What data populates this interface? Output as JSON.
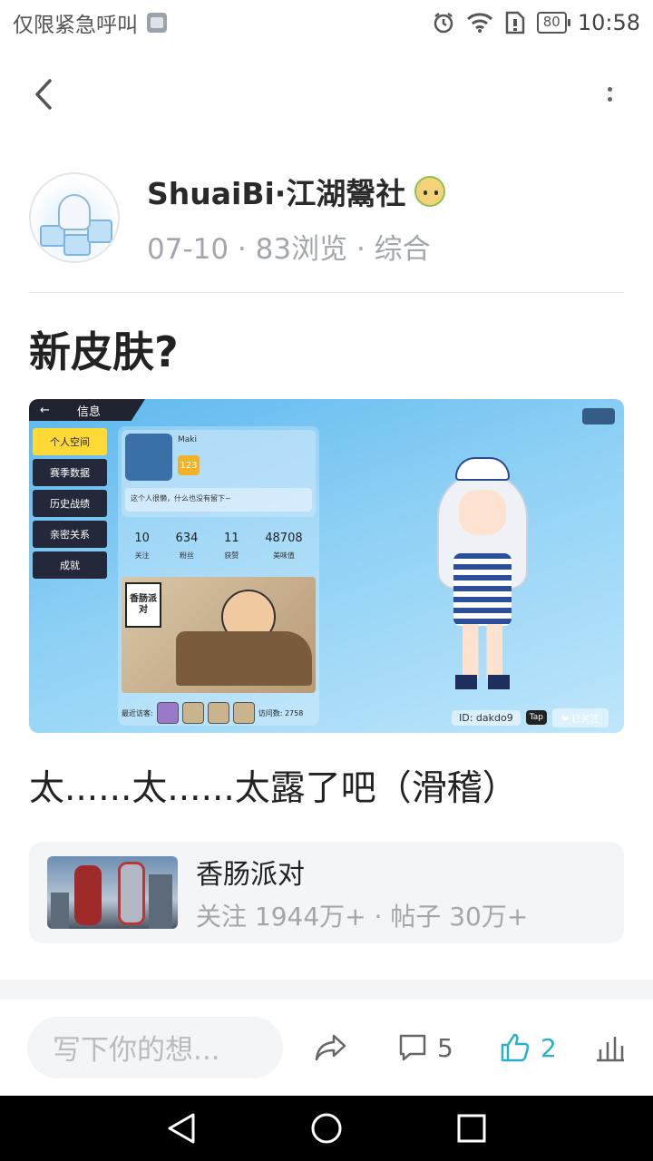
{
  "status_bar": {
    "carrier": "仅限紧急呼叫",
    "battery": "80",
    "time": "10:58"
  },
  "author": {
    "name": "ShuaiBi·江湖鬶社",
    "meta": "07-10 · 83浏览 · 综合"
  },
  "post": {
    "title": "新皮肤?",
    "body": "太......太......太露了吧（滑稽）"
  },
  "screenshot": {
    "header_title": "信息",
    "menu": [
      "个人空间",
      "赛季数据",
      "历史战绩",
      "亲密关系",
      "成就"
    ],
    "player_name": "Maki",
    "level": "123",
    "bio": "这个人很懒，什么也没有留下~",
    "stats": [
      {
        "value": "10",
        "label": "关注"
      },
      {
        "value": "634",
        "label": "粉丝"
      },
      {
        "value": "11",
        "label": "获赞"
      },
      {
        "value": "48708",
        "label": "美味值"
      }
    ],
    "banner_logo": "香肠派对",
    "visitors_label": "最近访客:",
    "visits": "访问数: 2758",
    "player_id": "ID: dakdo9",
    "tap_label": "Tap",
    "follow_label": "❤ 已关注"
  },
  "game_card": {
    "name": "香肠派对",
    "stats": "关注 1944万+ · 帖子 30万+"
  },
  "bottom_bar": {
    "comment_placeholder": "写下你的想...",
    "comment_count": "5",
    "like_count": "2"
  },
  "colors": {
    "accent": "#25b2c9",
    "muted_text": "#a3a7ad",
    "card_bg": "#f3f5f7"
  }
}
